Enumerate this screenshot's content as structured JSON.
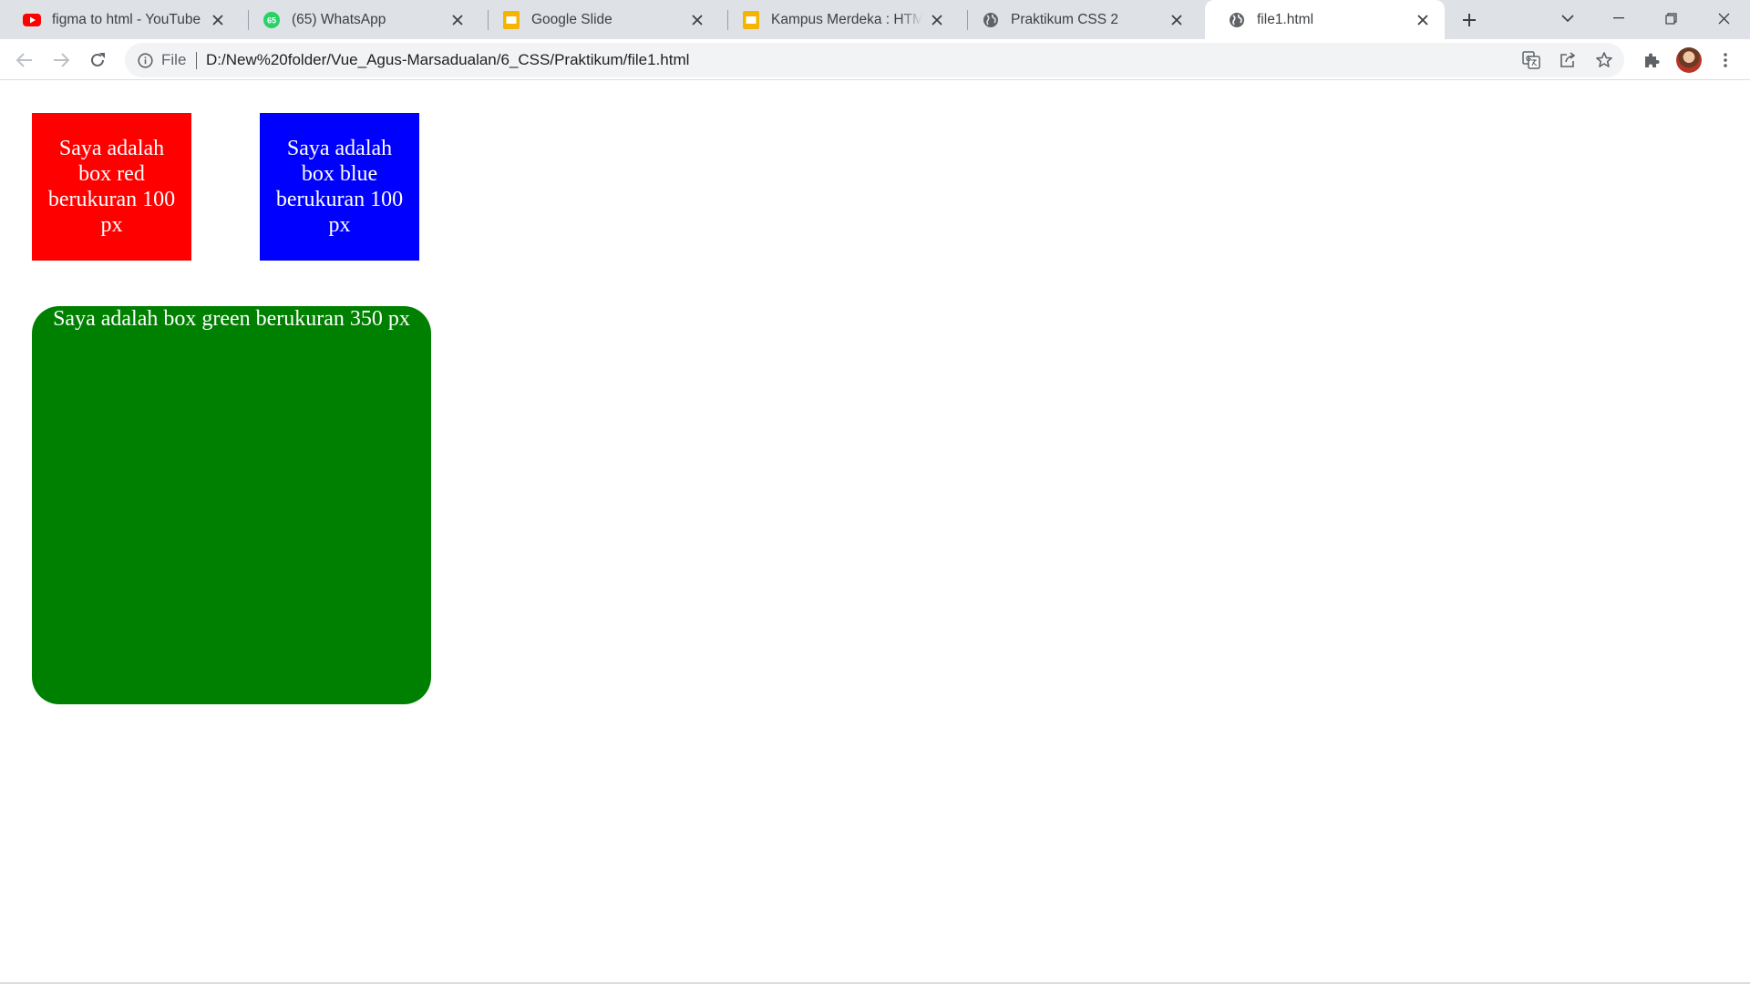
{
  "tabs": [
    {
      "title": "figma to html - YouTube",
      "icon": "youtube-icon"
    },
    {
      "title": "(65) WhatsApp",
      "icon": "whatsapp-icon",
      "badge": "65"
    },
    {
      "title": "Google Slide",
      "icon": "google-slides-icon"
    },
    {
      "title": "Kampus Merdeka : HTML &",
      "icon": "google-slides-icon"
    },
    {
      "title": "Praktikum CSS 2",
      "icon": "globe-icon"
    },
    {
      "title": "file1.html",
      "icon": "globe-icon",
      "active": true
    }
  ],
  "toolbar": {
    "scheme_label": "File",
    "url": "D:/New%20folder/Vue_Agus-Marsadualan/6_CSS/Praktikum/file1.html"
  },
  "content": {
    "red_box": {
      "text": "Saya adalah box red berukuran 100 px",
      "color": "#ff0000"
    },
    "blue_box": {
      "text": "Saya adalah box blue berukuran 100 px",
      "color": "#0000ff"
    },
    "green_box": {
      "text": "Saya adalah box green berukuran 350 px",
      "color": "#008000"
    }
  },
  "colors": {
    "tabstrip_bg": "#dee1e6",
    "omnibox_bg": "#f1f3f4",
    "text_white": "#ffffff"
  }
}
